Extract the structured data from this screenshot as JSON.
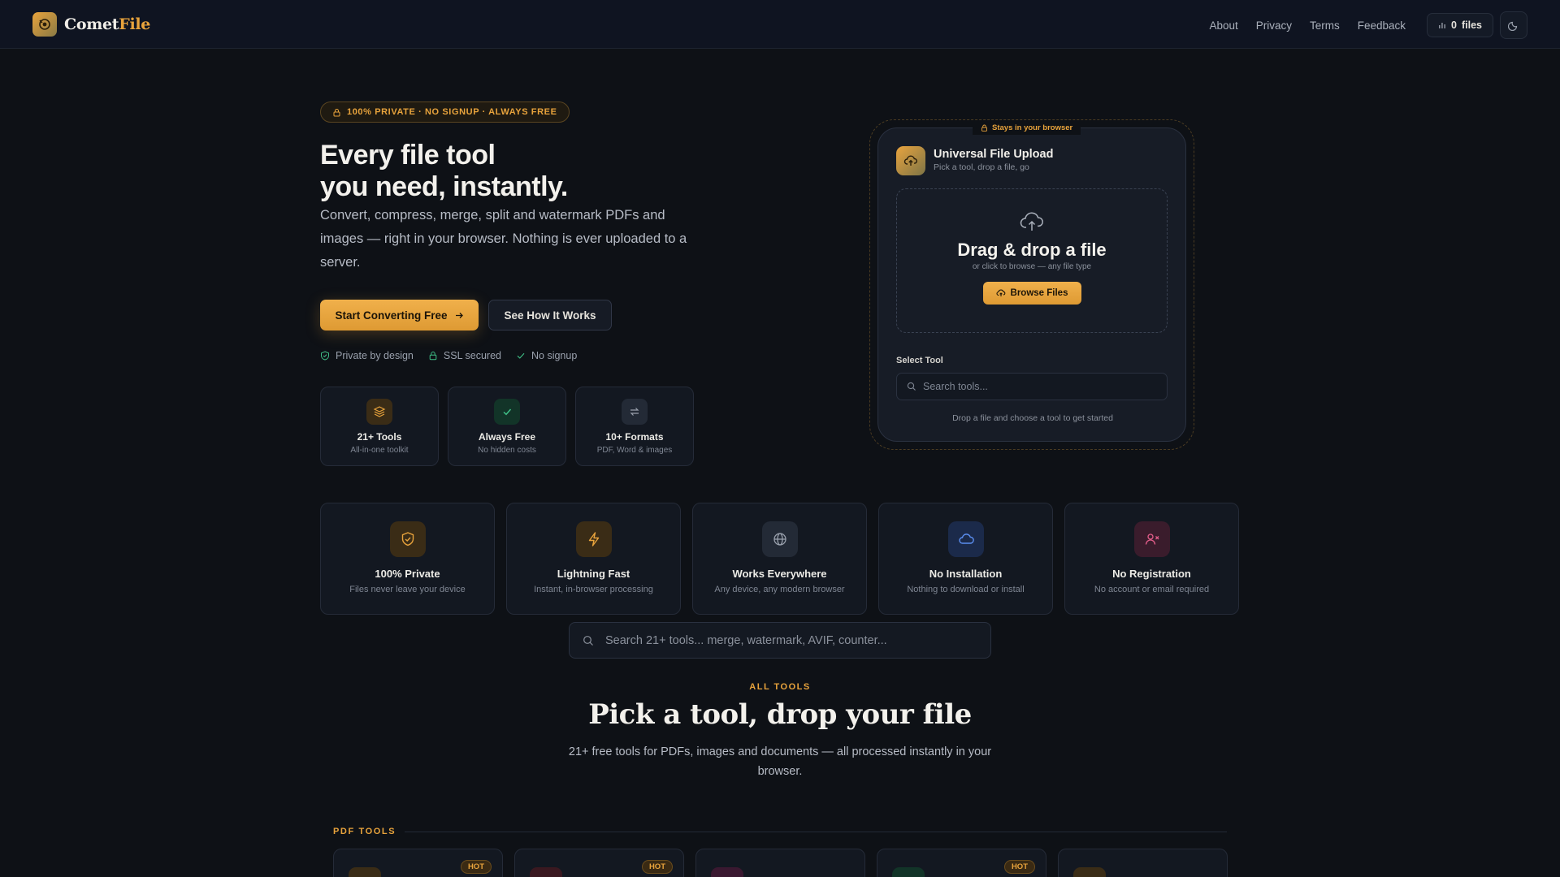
{
  "header": {
    "logo_name": "Comet",
    "logo_accent": "File",
    "nav": [
      "About",
      "Privacy",
      "Terms",
      "Feedback"
    ],
    "files_count": "0",
    "files_label": "files"
  },
  "hero": {
    "badge": "100% PRIVATE · NO SIGNUP · ALWAYS FREE",
    "title_line1": "Every file tool",
    "title_line2": "you need, instantly.",
    "description": "Convert, compress, merge, split and watermark PDFs and images — right in your browser. Nothing is ever uploaded to a server.",
    "primary_cta": "Start Converting Free",
    "secondary_cta": "See How It Works",
    "trust": [
      "Private by design",
      "SSL secured",
      "No signup"
    ],
    "stats": [
      {
        "title": "21+ Tools",
        "sub": "All-in-one toolkit",
        "icon": "layers-icon",
        "color": "#e8a33c"
      },
      {
        "title": "Always Free",
        "sub": "No hidden costs",
        "icon": "check-icon",
        "color": "#3fbf86"
      },
      {
        "title": "10+ Formats",
        "sub": "PDF, Word & images",
        "icon": "swap-icon",
        "color": "#8b919c"
      }
    ]
  },
  "upload": {
    "tag": "Stays in your browser",
    "title": "Universal File Upload",
    "subtitle": "Pick a tool, drop a file, go",
    "drop_title": "Drag & drop a file",
    "drop_sub": "or click to browse — any file type",
    "browse": "Browse Files",
    "select_label": "Select Tool",
    "search_placeholder": "Search tools...",
    "hint": "Drop a file and choose a tool to get started"
  },
  "features": [
    {
      "title": "100% Private",
      "sub": "Files never leave your device",
      "icon": "shield-icon",
      "color": "#e8a33c",
      "bg": "#3a2c16"
    },
    {
      "title": "Lightning Fast",
      "sub": "Instant, in-browser processing",
      "icon": "bolt-icon",
      "color": "#e8a33c",
      "bg": "#3a2c16"
    },
    {
      "title": "Works Everywhere",
      "sub": "Any device, any modern browser",
      "icon": "globe-icon",
      "color": "#9aa1ad",
      "bg": "#232a36"
    },
    {
      "title": "No Installation",
      "sub": "Nothing to download or install",
      "icon": "cloud-icon",
      "color": "#5b8ef0",
      "bg": "#1b2a4a"
    },
    {
      "title": "No Registration",
      "sub": "No account or email required",
      "icon": "user-x-icon",
      "color": "#e25d8a",
      "bg": "#3a1c2c"
    }
  ],
  "search": {
    "placeholder": "Search 21+ tools... merge, watermark, AVIF, counter..."
  },
  "tools_section": {
    "eyebrow": "ALL TOOLS",
    "title": "Pick a tool, drop your file",
    "description": "21+ free tools for PDFs, images and documents — all processed instantly in your browser.",
    "category": "PDF TOOLS",
    "hot_label": "HOT",
    "cards": [
      {
        "hot": true,
        "color": "#3a2c16"
      },
      {
        "hot": true,
        "color": "#3a1820"
      },
      {
        "hot": false,
        "color": "#3a1830"
      },
      {
        "hot": true,
        "color": "#123428"
      },
      {
        "hot": false,
        "color": "#3a2c16"
      }
    ]
  }
}
